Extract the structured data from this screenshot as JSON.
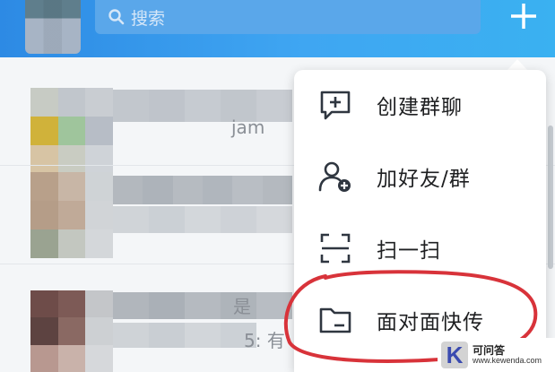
{
  "search": {
    "placeholder": "搜索"
  },
  "header": {
    "add_icon": "plus-icon"
  },
  "chat_list": {
    "visible_text": [
      {
        "text": "jam"
      },
      {
        "text": "是"
      },
      {
        "text": "5: 有"
      }
    ]
  },
  "popup_menu": {
    "items": [
      {
        "label": "创建群聊",
        "icon": "message-plus-icon"
      },
      {
        "label": "加好友/群",
        "icon": "user-add-icon"
      },
      {
        "label": "扫一扫",
        "icon": "scan-icon"
      },
      {
        "label": "面对面快传",
        "icon": "folder-icon"
      }
    ]
  },
  "annotation": {
    "color": "#d8333a"
  },
  "watermark": {
    "logo_letter": "K",
    "title": "可问答",
    "url": "www.kewenda.com"
  },
  "colors": {
    "header_blue": "#2d8ae4",
    "search_bg": "#5aa7ea",
    "menu_bg": "#ffffff"
  }
}
